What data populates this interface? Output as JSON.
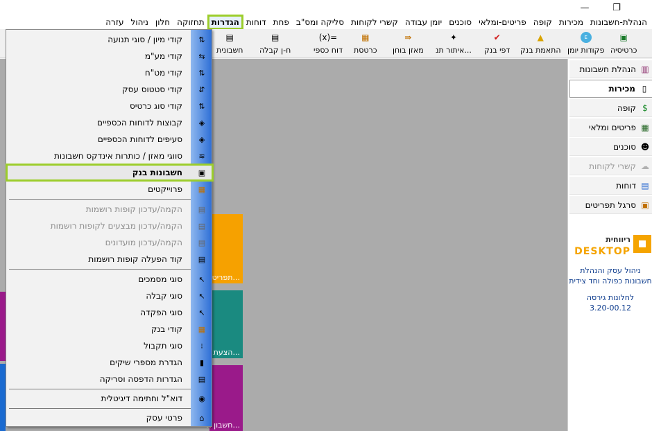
{
  "menu": {
    "items": [
      "הנהלת-חשבונות",
      "מכירות",
      "קופה",
      "פריטים-ומלאי",
      "סוכנים",
      "יומן עבודה",
      "קשרי לקוחות",
      "סליקה ומס\"ב",
      "פחת",
      "דוחות",
      "הגדרות",
      "תחזוקה",
      "חלון",
      "ניהול",
      "עזרה"
    ],
    "active": "הגדרות"
  },
  "window_controls": {
    "minimize": "—",
    "maximize": "❐"
  },
  "toolbar": {
    "items": [
      "כרטיסיה",
      "פקודות יומן",
      "התאמת בנק",
      "דפי בנק",
      "איתור תנ...",
      "מאזן בוחן",
      "כרטסת",
      "דוח כספי",
      "ח-ן קבלה",
      "חשבונית"
    ]
  },
  "right_panel": {
    "items": [
      {
        "label": "הנהלת חשבונות",
        "icon": "ledger-icon"
      },
      {
        "label": "מכירות",
        "icon": "sales-doc-icon"
      },
      {
        "label": "קופה",
        "icon": "cash-register-icon"
      },
      {
        "label": "פריטים ומלאי",
        "icon": "inventory-icon"
      },
      {
        "label": "סוכנים",
        "icon": "agent-icon"
      },
      {
        "label": "קשרי לקוחות",
        "icon": "customers-icon"
      },
      {
        "label": "דוחות",
        "icon": "reports-icon"
      },
      {
        "label": "סרגל תפריטים",
        "icon": "menu-bar-icon"
      }
    ],
    "active": "מכירות",
    "disabled": "קשרי לקוחות"
  },
  "brand": {
    "logo_top": "ריווחית",
    "logo_bottom": "DESKTOP",
    "line1": "ניהול עסק והנהלת",
    "line2": "חשבונות כפולה וחד צידית",
    "line3": "לחלונות גירסה",
    "version": "3.20-00.12"
  },
  "tiles": {
    "orange_label": "תפריט מ...",
    "teal_label": "הצעת מ...",
    "purple_label": "חשבון ה..."
  },
  "dropdown": {
    "items": [
      {
        "label": "קודי מיון / סוגי תנועה",
        "icon": "sort-codes-icon"
      },
      {
        "label": "קודי מע\"מ",
        "icon": "vat-codes-icon"
      },
      {
        "label": "קודי מט\"ח",
        "icon": "currency-codes-icon"
      },
      {
        "label": "קודי סטטוס עסק",
        "icon": "business-status-icon"
      },
      {
        "label": "קודי סוג כרטיס",
        "icon": "card-type-icon"
      },
      {
        "label": "קבוצות לדוחות הכספיים",
        "icon": "report-groups-icon"
      },
      {
        "label": "סעיפים לדוחות הכספיים",
        "icon": "report-sections-icon"
      },
      {
        "label": "סווגי מאזן / כותרות אינדקס חשבונות",
        "icon": "balance-categories-icon"
      },
      {
        "label": "חשבונות בנק",
        "icon": "bank-accounts-icon"
      },
      {
        "label": "פרוייקטים",
        "icon": "projects-icon"
      },
      {
        "label": "הקמה/עדכון קופות רושמות",
        "icon": "cash-registers-icon"
      },
      {
        "label": "הקמה/עדכון מבצעים לקופות רושמות",
        "icon": "register-promotions-icon"
      },
      {
        "label": "הקמה/עדכון מועדונים",
        "icon": "clubs-icon"
      },
      {
        "label": "קוד הפעלה קופות רושמות",
        "icon": "register-activation-icon"
      },
      {
        "label": "סוגי מסמכים",
        "icon": "document-types-icon"
      },
      {
        "label": "סוגי קבלה",
        "icon": "receipt-types-icon"
      },
      {
        "label": "סוגי הפקדה",
        "icon": "deposit-types-icon"
      },
      {
        "label": "קודי בנק",
        "icon": "bank-codes-icon"
      },
      {
        "label": "סוגי תקבול",
        "icon": "payment-types-icon"
      },
      {
        "label": "הגדרת מספרי שיקים",
        "icon": "check-numbers-icon"
      },
      {
        "label": "הגדרות הדפסה וסריקה",
        "icon": "print-scan-icon"
      },
      {
        "label": "דוא\"ל וחתימה דיגיטלית",
        "icon": "email-signature-icon"
      },
      {
        "label": "פרטי עסק",
        "icon": "business-details-icon"
      }
    ],
    "highlighted": "חשבונות בנק",
    "disabled": [
      "הקמה/עדכון קופות רושמות",
      "הקמה/עדכון מבצעים לקופות רושמות",
      "הקמה/עדכון מועדונים"
    ]
  }
}
